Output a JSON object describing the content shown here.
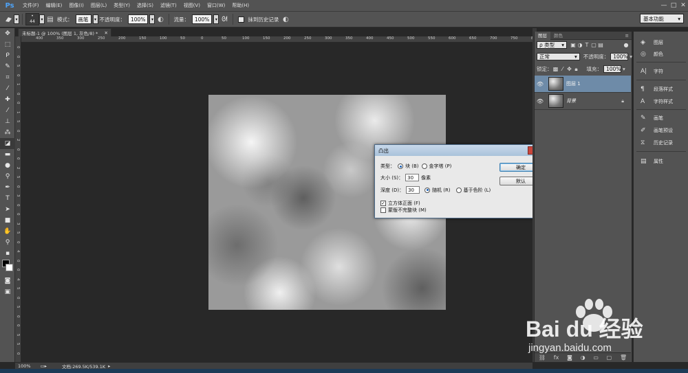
{
  "app": {
    "logo": "Ps",
    "menu": [
      "文件(F)",
      "编辑(E)",
      "图像(I)",
      "图层(L)",
      "类型(Y)",
      "选择(S)",
      "滤镜(T)",
      "视图(V)",
      "窗口(W)",
      "帮助(H)"
    ],
    "window_controls": [
      "—",
      "□",
      "✕"
    ]
  },
  "options_bar": {
    "brush_size": "44",
    "mode_label": "模式：",
    "mode_value": "画笔",
    "opacity_label": "不透明度：",
    "opacity_value": "100%",
    "flow_label": "流量：",
    "flow_value": "100%",
    "history_label": "抹到历史记录",
    "workspace": "基本功能"
  },
  "document": {
    "tab_title": "未标题-1 @ 100% (图层 1, 灰色/8) *",
    "ruler_top": [
      "400",
      "350",
      "300",
      "250",
      "200",
      "150",
      "100",
      "50",
      "0",
      "50",
      "100",
      "150",
      "200",
      "250",
      "300",
      "350",
      "400",
      "450",
      "500",
      "550",
      "600",
      "650",
      "700",
      "750",
      "800"
    ],
    "ruler_left": [
      "0",
      "0",
      "5",
      "0",
      "1",
      "0",
      "0",
      "1",
      "5",
      "0",
      "2",
      "0",
      "0",
      "2",
      "5",
      "0",
      "3",
      "0",
      "0",
      "3",
      "5",
      "0",
      "4",
      "0",
      "0",
      "4",
      "5",
      "0",
      "5",
      "0",
      "0",
      "5",
      "5",
      "0"
    ]
  },
  "dialog": {
    "title": "凸出",
    "close": "✕",
    "type_label": "类型：",
    "type_block": "块 (B)",
    "type_pyramid": "金字塔 (P)",
    "size_label": "大小 (S)：",
    "size_value": "30",
    "size_unit": "像素",
    "depth_label": "深度 (D)：",
    "depth_value": "30",
    "depth_random": "随机 (R)",
    "depth_level": "基于色阶 (L)",
    "solid_front": "立方体正面 (F)",
    "mask_incomplete": "蒙版不完整块 (M)",
    "ok": "确定",
    "default": "默认"
  },
  "layers_panel": {
    "tabs": [
      "图层",
      "颜色"
    ],
    "filter_kind": "ρ 类型",
    "blend_mode": "正常",
    "opacity_label": "不透明度：",
    "opacity_value": "100%",
    "lock_label": "锁定：",
    "fill_label": "填充：",
    "fill_value": "100%",
    "layers": [
      {
        "name": "图层 1",
        "selected": true
      },
      {
        "name": "背景",
        "selected": false
      }
    ]
  },
  "dock": {
    "items": [
      "图层",
      "颜色",
      "字符",
      "段落样式",
      "字符样式",
      "画笔",
      "画笔预设",
      "历史记录",
      "属性"
    ]
  },
  "status": {
    "zoom": "100%",
    "doc_info": "文档:269.5K/539.1K"
  },
  "watermark": {
    "brand": "Bai du 经验",
    "url": "jingyan.baidu.com"
  }
}
